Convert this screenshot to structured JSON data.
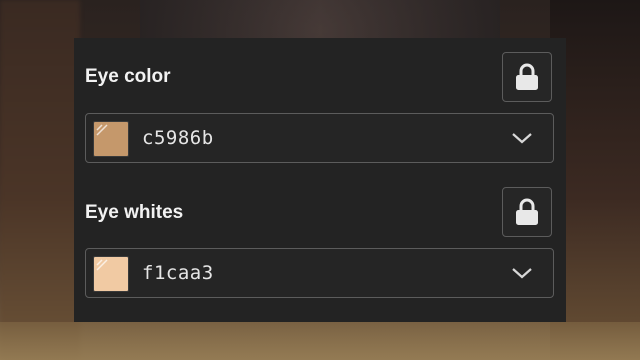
{
  "colors": {
    "panel_bg": "#232323",
    "text": "#f2f2f2",
    "border": "#5c5c5c"
  },
  "eye_color": {
    "label": "Eye color",
    "lock_icon": "lock-icon",
    "value": "c5986b",
    "swatch_hex": "#c5986b",
    "dropdown_icon": "chevron-down-icon"
  },
  "eye_whites": {
    "label": "Eye whites",
    "lock_icon": "lock-icon",
    "value": "f1caa3",
    "swatch_hex": "#f1caa3",
    "dropdown_icon": "chevron-down-icon"
  }
}
